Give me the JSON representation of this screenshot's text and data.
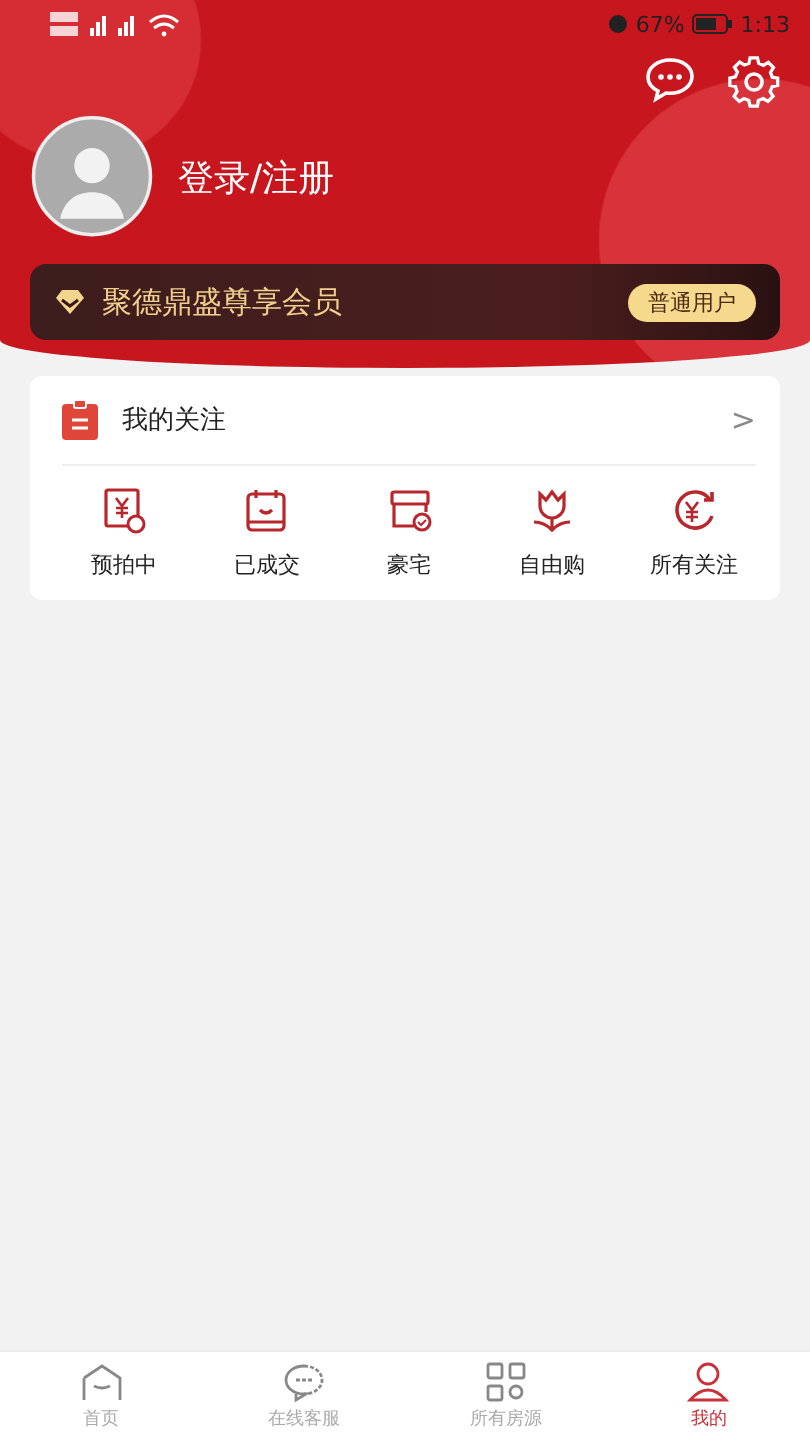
{
  "status_bar": {
    "battery": "67%",
    "time": "1:13"
  },
  "profile": {
    "login": "登录/注册"
  },
  "membership": {
    "title": "聚德鼎盛尊享会员",
    "badge": "普通用户"
  },
  "follows": {
    "title": "我的关注",
    "arrow": ">",
    "shortcuts": [
      {
        "label": "预拍中"
      },
      {
        "label": "已成交"
      },
      {
        "label": "豪宅"
      },
      {
        "label": "自由购"
      },
      {
        "label": "所有关注"
      }
    ]
  },
  "tab_bar": [
    {
      "label": "首页",
      "selected": false
    },
    {
      "label": "在线客服",
      "selected": false
    },
    {
      "label": "所有房源",
      "selected": false
    },
    {
      "label": "我的",
      "selected": true
    }
  ]
}
